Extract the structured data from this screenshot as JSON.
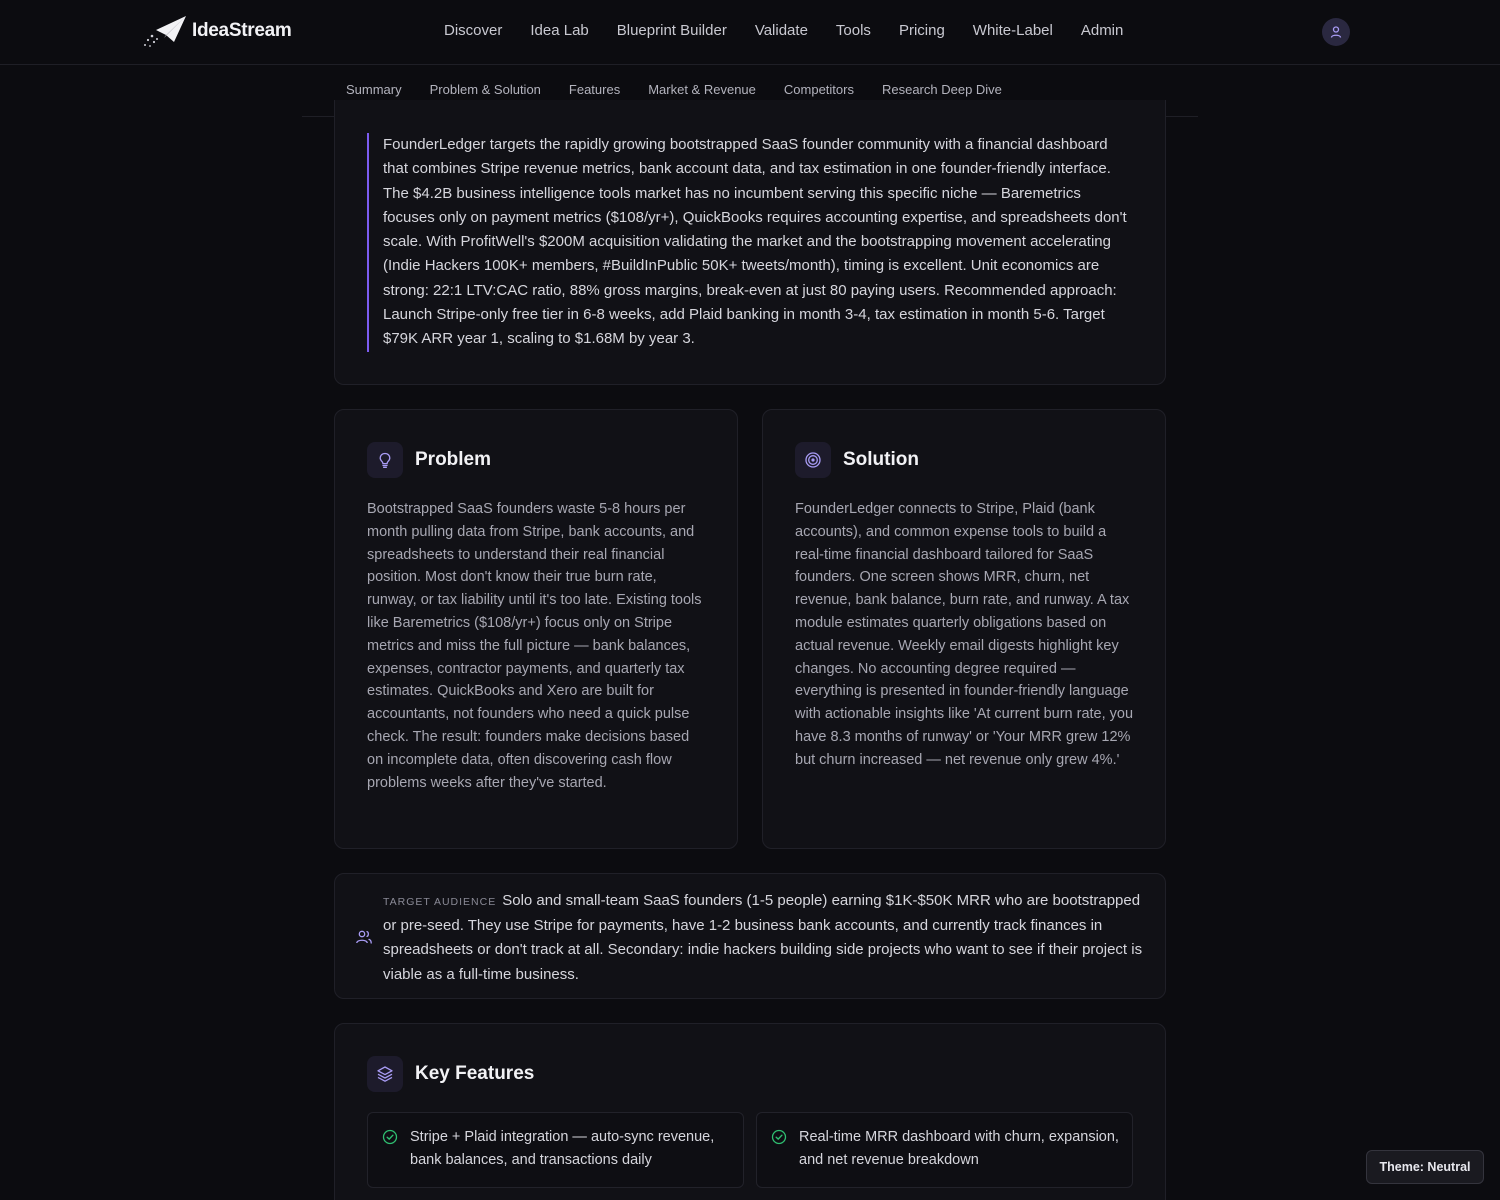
{
  "brand": {
    "name": "IdeaStream"
  },
  "nav": {
    "items": [
      "Discover",
      "Idea Lab",
      "Blueprint Builder",
      "Validate",
      "Tools",
      "Pricing",
      "White-Label",
      "Admin"
    ]
  },
  "subnav": {
    "items": [
      "Summary",
      "Problem & Solution",
      "Features",
      "Market & Revenue",
      "Competitors",
      "Research Deep Dive"
    ]
  },
  "summary": {
    "text": "FounderLedger targets the rapidly growing bootstrapped SaaS founder community with a financial dashboard that combines Stripe revenue metrics, bank account data, and tax estimation in one founder-friendly interface. The $4.2B business intelligence tools market has no incumbent serving this specific niche — Baremetrics focuses only on payment metrics ($108/yr+), QuickBooks requires accounting expertise, and spreadsheets don't scale. With ProfitWell's $200M acquisition validating the market and the bootstrapping movement accelerating (Indie Hackers 100K+ members, #BuildInPublic 50K+ tweets/month), timing is excellent. Unit economics are strong: 22:1 LTV:CAC ratio, 88% gross margins, break-even at just 80 paying users. Recommended approach: Launch Stripe-only free tier in 6-8 weeks, add Plaid banking in month 3-4, tax estimation in month 5-6. Target $79K ARR year 1, scaling to $1.68M by year 3."
  },
  "problem": {
    "title": "Problem",
    "text": "Bootstrapped SaaS founders waste 5-8 hours per month pulling data from Stripe, bank accounts, and spreadsheets to understand their real financial position. Most don't know their true burn rate, runway, or tax liability until it's too late. Existing tools like Baremetrics ($108/yr+) focus only on Stripe metrics and miss the full picture — bank balances, expenses, contractor payments, and quarterly tax estimates. QuickBooks and Xero are built for accountants, not founders who need a quick pulse check. The result: founders make decisions based on incomplete data, often discovering cash flow problems weeks after they've started."
  },
  "solution": {
    "title": "Solution",
    "text": "FounderLedger connects to Stripe, Plaid (bank accounts), and common expense tools to build a real-time financial dashboard tailored for SaaS founders. One screen shows MRR, churn, net revenue, bank balance, burn rate, and runway. A tax module estimates quarterly obligations based on actual revenue. Weekly email digests highlight key changes. No accounting degree required — everything is presented in founder-friendly language with actionable insights like 'At current burn rate, you have 8.3 months of runway' or 'Your MRR grew 12% but churn increased — net revenue only grew 4%.'"
  },
  "audience": {
    "label": "Target Audience",
    "text": "Solo and small-team SaaS founders (1-5 people) earning $1K-$50K MRR who are bootstrapped or pre-seed. They use Stripe for payments, have 1-2 business bank accounts, and currently track finances in spreadsheets or don't track at all. Secondary: indie hackers building side projects who want to see if their project is viable as a full-time business."
  },
  "features": {
    "title": "Key Features",
    "items": [
      "Stripe + Plaid integration — auto-sync revenue, bank balances, and transactions daily",
      "Real-time MRR dashboard with churn, expansion, and net revenue breakdown"
    ]
  },
  "theme_badge": {
    "label": "Theme: Neutral"
  },
  "colors": {
    "accent": "#7c5cf0",
    "success": "#2fbf71",
    "background": "#0c0c10",
    "card": "#111116"
  }
}
